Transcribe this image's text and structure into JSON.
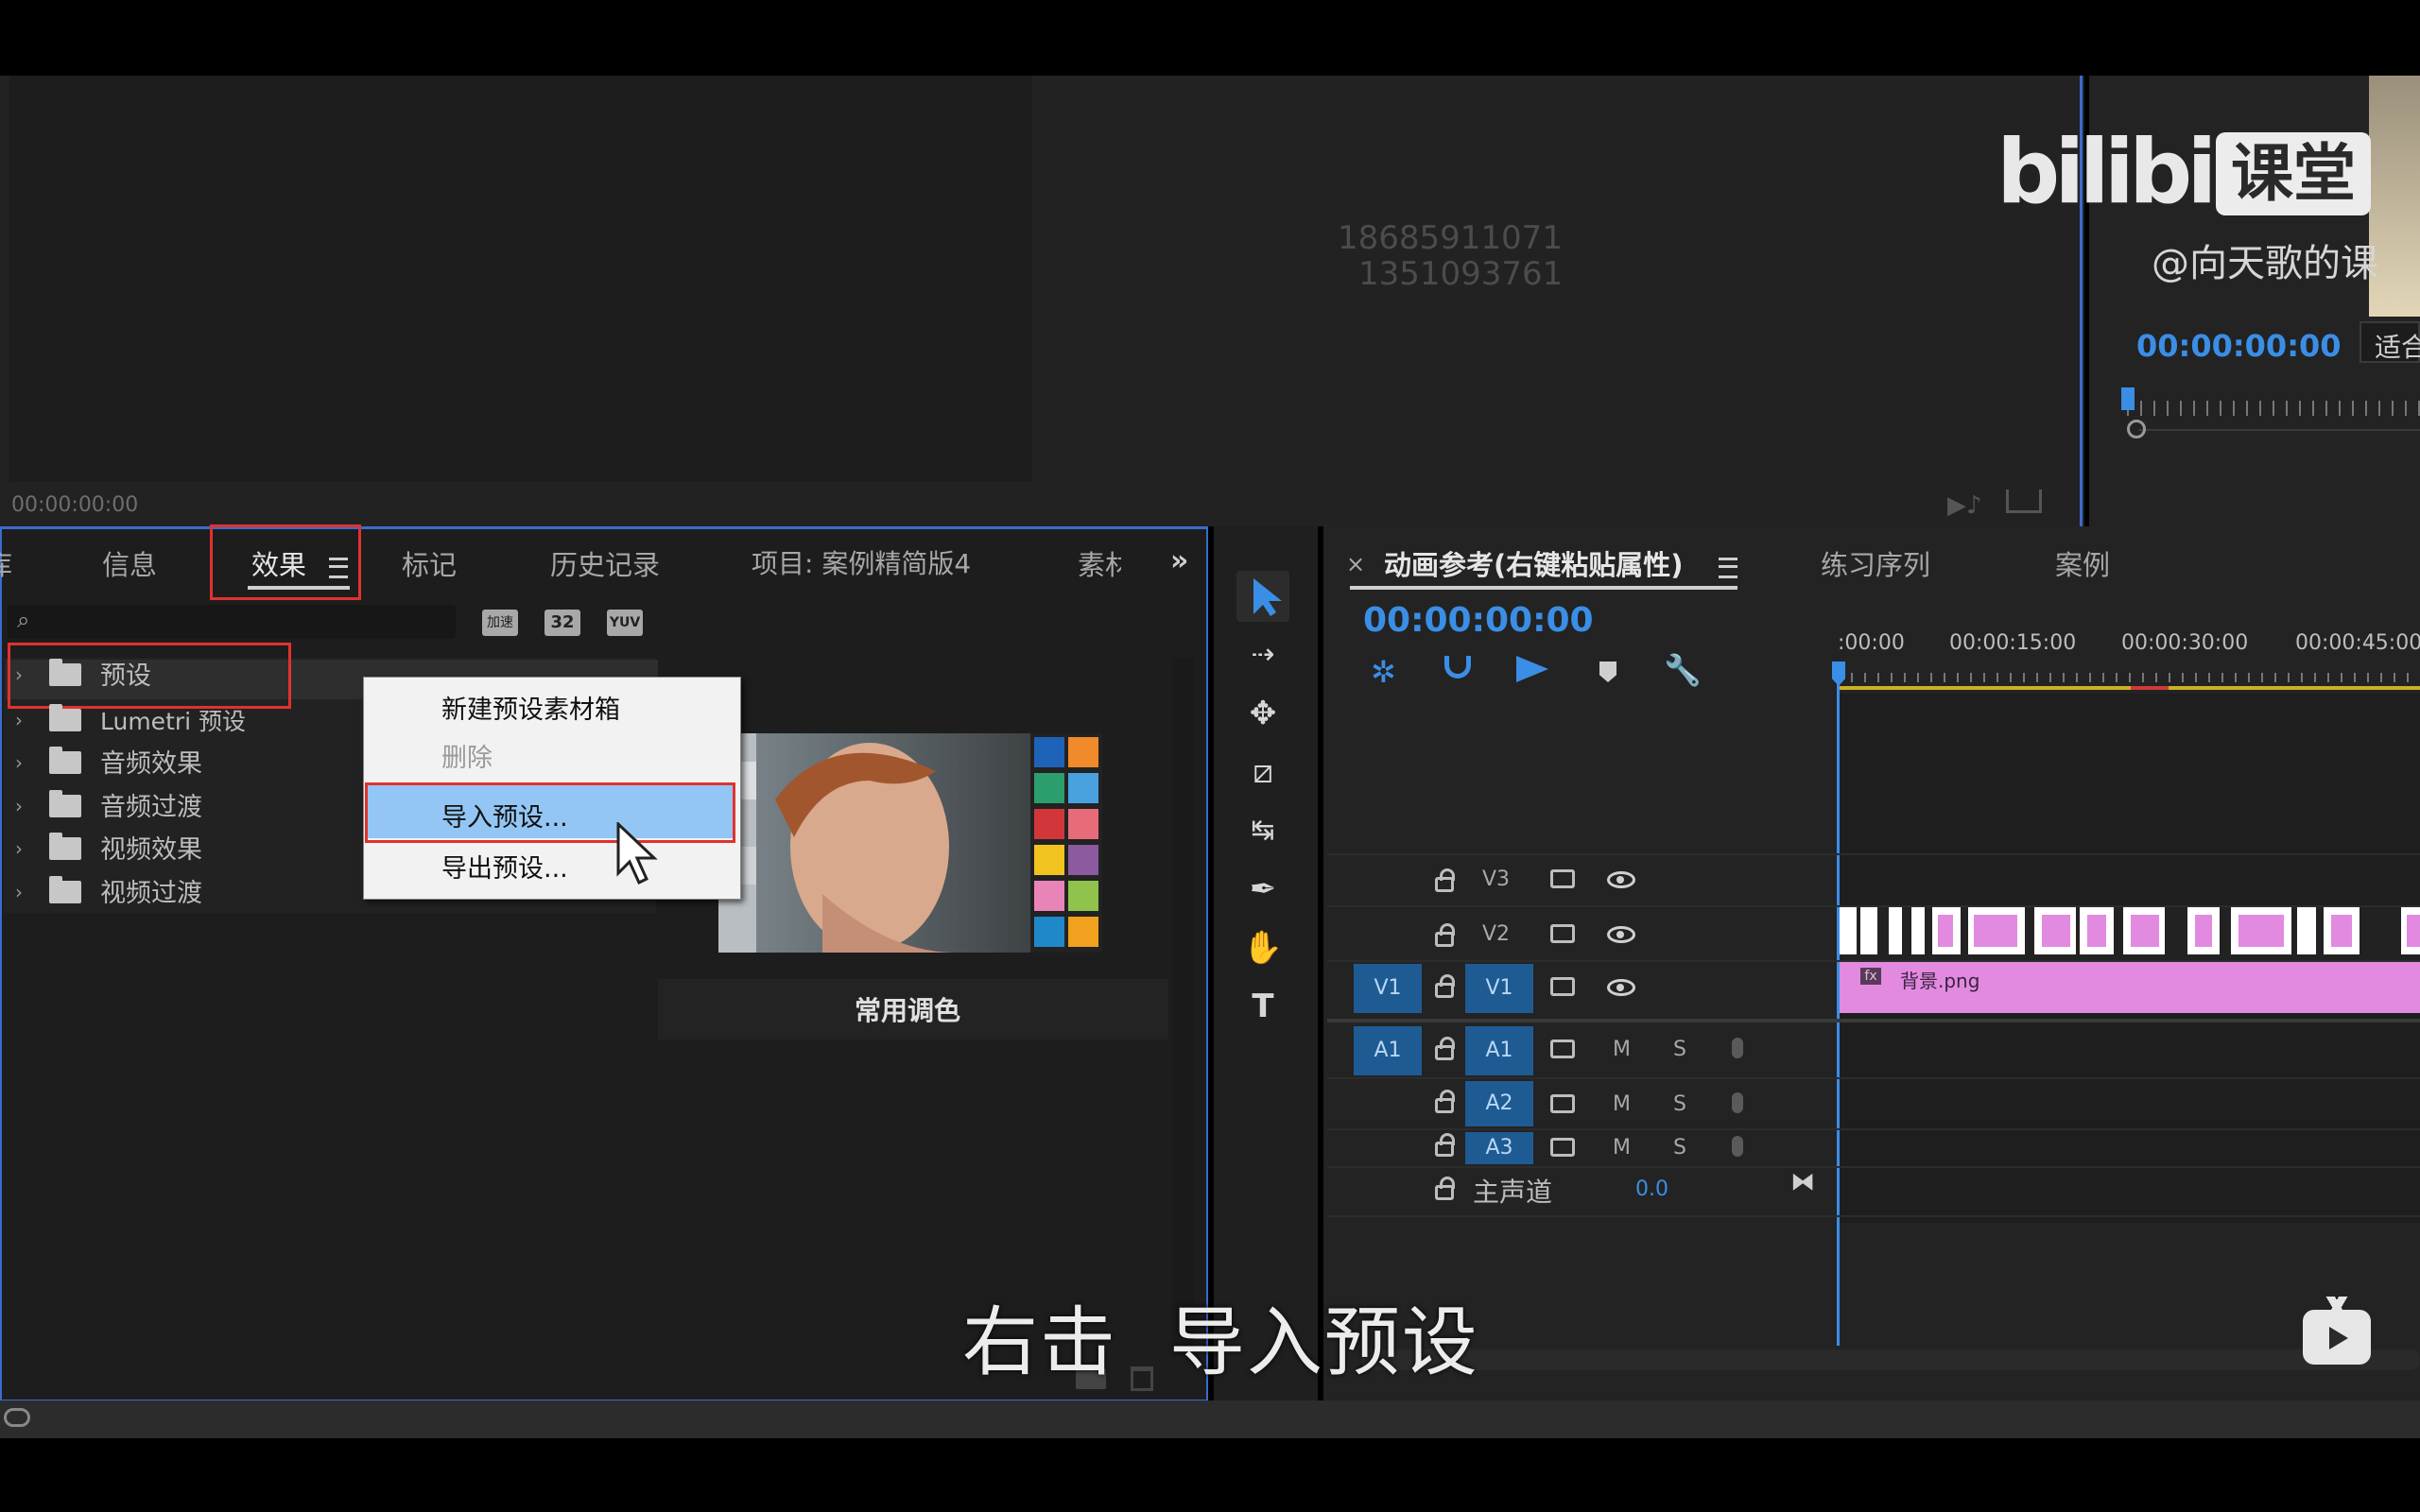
{
  "watermark": {
    "brand": "bilibili",
    "brand_suffix": "课堂",
    "author": "@向天歌的课"
  },
  "source_monitor": {
    "overlay_numbers": [
      "18685911071",
      "1351093761"
    ],
    "timecode": "00:00:00:00"
  },
  "program_monitor": {
    "timecode": "00:00:00:00",
    "fit_label": "适合"
  },
  "effects_panel": {
    "tabs": [
      "库",
      "信息",
      "效果",
      "标记",
      "历史记录",
      "项目: 案例精简版4",
      "素材"
    ],
    "active_tab": "效果",
    "search_placeholder": "",
    "filter_buttons": [
      "加速",
      "32",
      "YUV"
    ],
    "tree": [
      {
        "label": "预设",
        "type": "preset-folder"
      },
      {
        "label": "Lumetri 预设",
        "type": "preset-folder"
      },
      {
        "label": "音频效果",
        "type": "folder"
      },
      {
        "label": "音频过渡",
        "type": "folder"
      },
      {
        "label": "视频效果",
        "type": "folder"
      },
      {
        "label": "视频过渡",
        "type": "folder"
      }
    ],
    "preview_caption": "常用调色"
  },
  "context_menu": {
    "items": [
      {
        "label": "新建预设素材箱",
        "enabled": true
      },
      {
        "label": "删除",
        "enabled": false
      },
      {
        "label": "导入预设...",
        "enabled": true,
        "highlighted": true
      },
      {
        "label": "导出预设...",
        "enabled": true
      }
    ]
  },
  "timeline": {
    "tabs": [
      "动画参考(右键粘贴属性)",
      "练习序列",
      "案例"
    ],
    "active_tab": "动画参考(右键粘贴属性)",
    "timecode": "00:00:00:00",
    "ruler_labels": [
      ":00:00",
      "00:00:15:00",
      "00:00:30:00",
      "00:00:45:00"
    ],
    "video_tracks": [
      "V3",
      "V2",
      "V1"
    ],
    "audio_tracks": [
      "A1",
      "A2",
      "A3"
    ],
    "source_patch_video": "V1",
    "source_patch_audio": "A1",
    "master_label": "主声道",
    "master_value": "0.0",
    "mute_label": "M",
    "solo_label": "S",
    "clip_label": "背景.png",
    "clip_fx": "fx"
  },
  "subtitle": "右击  导入预设",
  "colors": {
    "accent_blue": "#3a8ee6",
    "clip_pink": "#e28ae0",
    "highlight_red": "#e0322f",
    "menu_highlight": "#93c6f4"
  }
}
